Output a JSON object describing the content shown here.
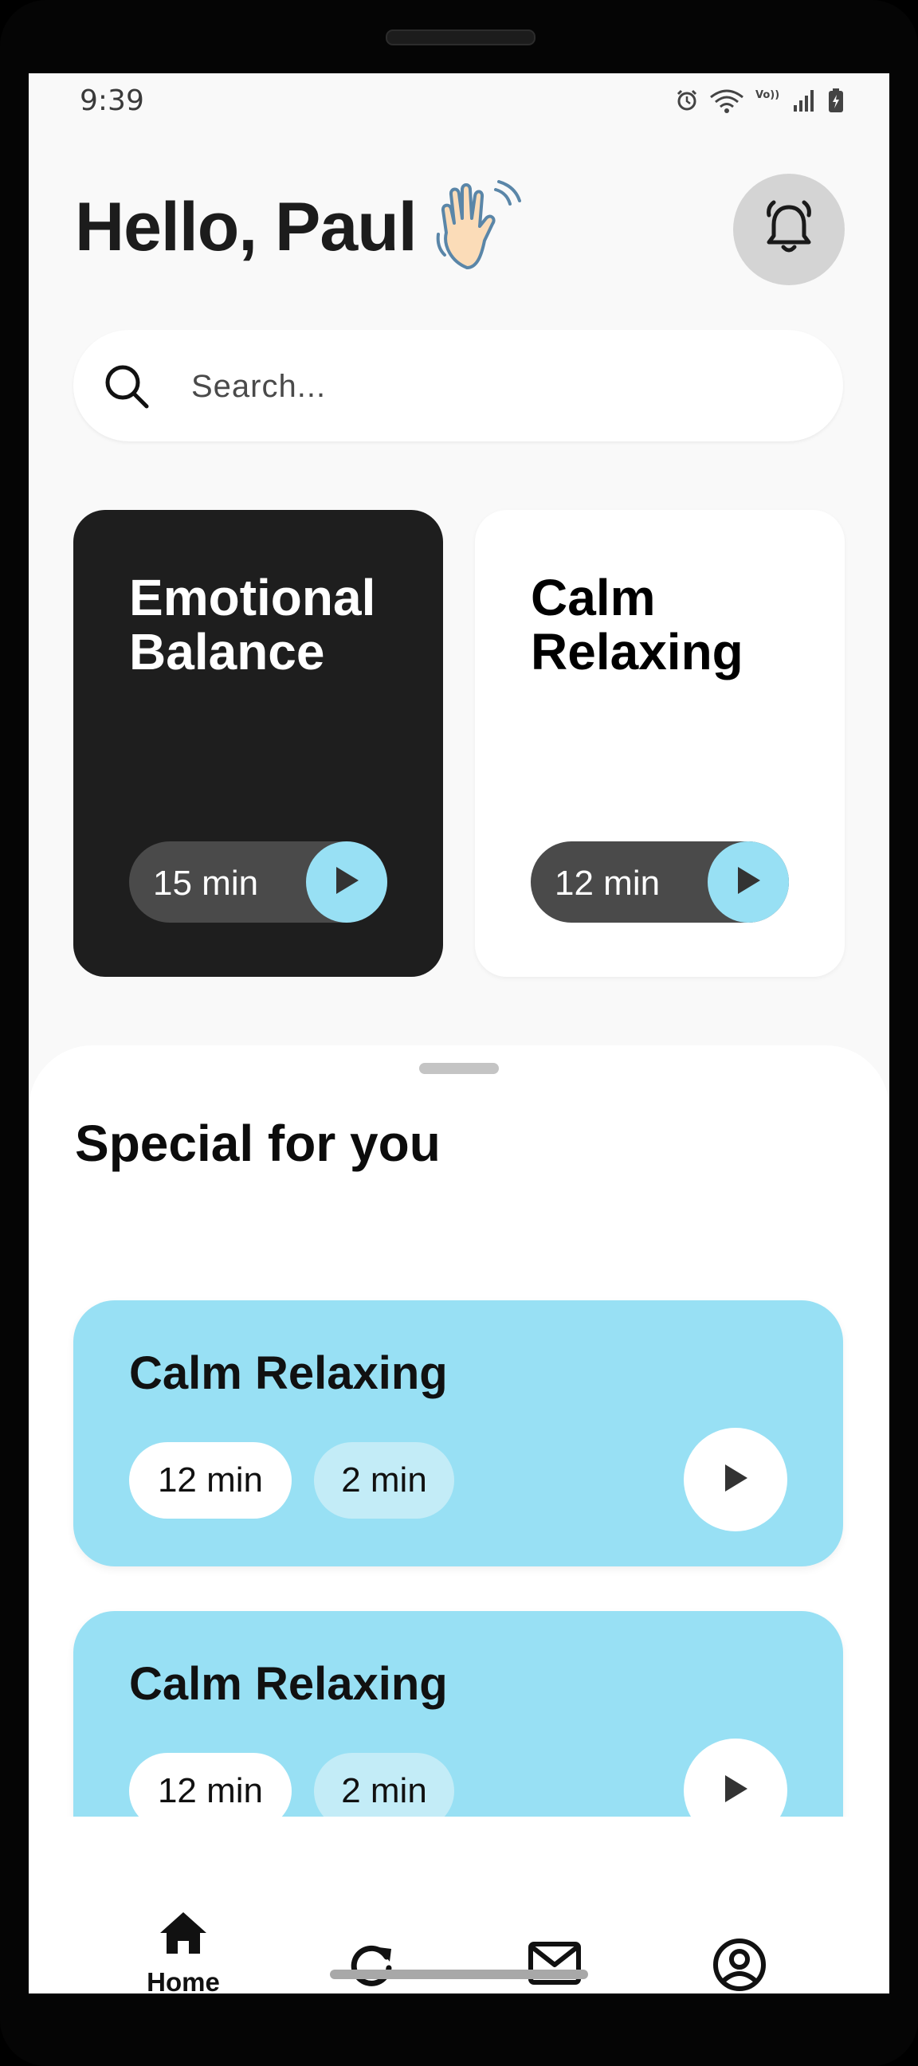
{
  "status_bar": {
    "time": "9:39",
    "icons": [
      "alarm-icon",
      "wifi-icon",
      "volte-icon",
      "signal-icon",
      "battery-icon"
    ],
    "volte_text": "Vo)) LTE"
  },
  "header": {
    "greeting": "Hello, Paul",
    "emoji": "waving-hand",
    "notification_icon": "bell-icon"
  },
  "search": {
    "placeholder": "Search..."
  },
  "featured": [
    {
      "title_line1": "Emotional",
      "title_line2": "Balance",
      "duration": "15 min",
      "theme": "dark"
    },
    {
      "title_line1": "Calm",
      "title_line2": "Relaxing",
      "duration": "12 min",
      "theme": "light"
    }
  ],
  "special": {
    "title": "Special for you",
    "items": [
      {
        "title": "Calm Relaxing",
        "chip1": "12 min",
        "chip2": "2 min"
      },
      {
        "title": "Calm Relaxing",
        "chip1": "12 min",
        "chip2": "2 min"
      }
    ]
  },
  "nav": {
    "items": [
      {
        "label": "Home",
        "icon": "home-icon",
        "active": true
      },
      {
        "label": "",
        "icon": "refresh-icon"
      },
      {
        "label": "",
        "icon": "mail-icon"
      },
      {
        "label": "",
        "icon": "profile-icon"
      }
    ]
  },
  "colors": {
    "accent": "#98e0f4",
    "dark_card": "#1e1e1e",
    "chip_light": "#c3ecf7",
    "background": "#f9f9f9"
  }
}
